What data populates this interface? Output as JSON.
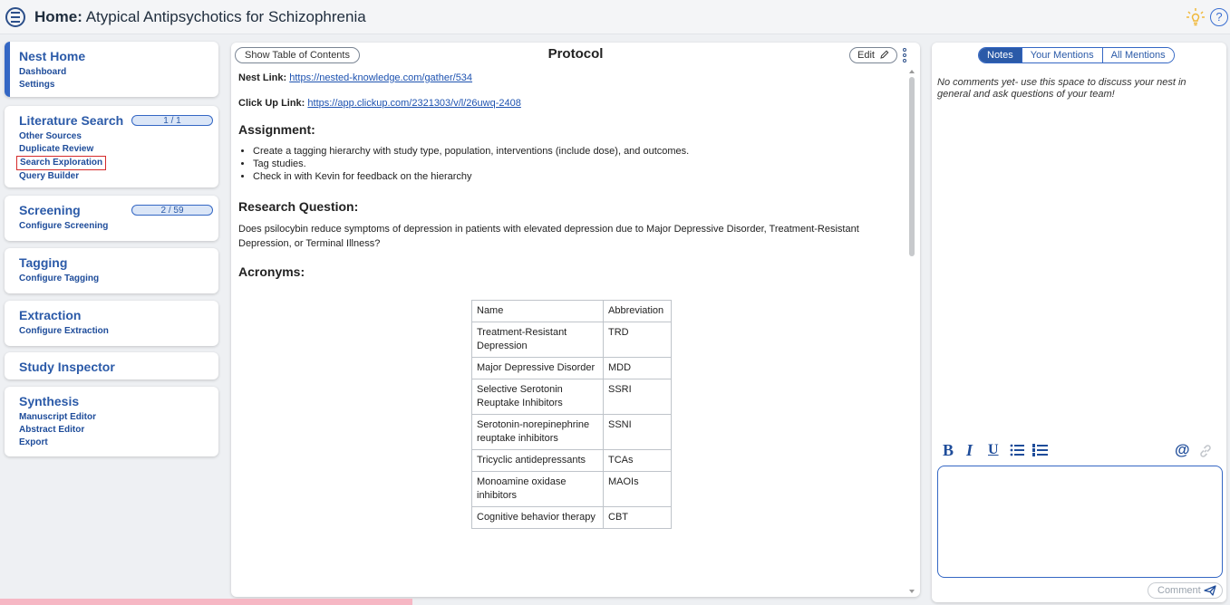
{
  "header": {
    "title_bold": "Home:",
    "title_rest": " Atypical Antipsychotics for Schizophrenia"
  },
  "sidebar": {
    "nest_home": {
      "title": "Nest Home",
      "links": [
        "Dashboard",
        "Settings"
      ]
    },
    "literature_search": {
      "title": "Literature Search",
      "progress": "1 / 1",
      "links": [
        "Other Sources",
        "Duplicate Review",
        "Search Exploration",
        "Query Builder"
      ]
    },
    "screening": {
      "title": "Screening",
      "progress": "2 / 59",
      "links": [
        "Configure Screening"
      ]
    },
    "tagging": {
      "title": "Tagging",
      "links": [
        "Configure Tagging"
      ]
    },
    "extraction": {
      "title": "Extraction",
      "links": [
        "Configure Extraction"
      ]
    },
    "study_inspector": {
      "title": "Study Inspector"
    },
    "synthesis": {
      "title": "Synthesis",
      "links": [
        "Manuscript Editor",
        "Abstract Editor",
        "Export"
      ]
    }
  },
  "protocol": {
    "toc_label": "Show Table of Contents",
    "title": "Protocol",
    "edit_label": "Edit",
    "nest_link_label": "Nest Link:",
    "nest_link_url": "https://nested-knowledge.com/gather/534",
    "clickup_label": "Click Up Link:",
    "clickup_url": "https://app.clickup.com/2321303/v/l/26uwq-2408",
    "assignment_heading": "Assignment:",
    "assignment_items": [
      "Create a tagging hierarchy with study type, population, interventions (include dose), and outcomes.",
      "Tag studies.",
      "Check in with Kevin for feedback on the hierarchy"
    ],
    "research_heading": "Research Question:",
    "research_text": "Does psilocybin reduce symptoms of depression in patients with elevated depression due to Major Depressive Disorder, Treatment-Resistant Depression, or Terminal Illness?",
    "acronyms_heading": "Acronyms:",
    "acronyms_table": {
      "headers": [
        "Name",
        "Abbreviation"
      ],
      "rows": [
        [
          "Treatment-Resistant Depression",
          "TRD"
        ],
        [
          "Major Depressive Disorder",
          "MDD"
        ],
        [
          "Selective Serotonin Reuptake Inhibitors",
          "SSRI"
        ],
        [
          "Serotonin-norepinephrine reuptake inhibitors",
          "SSNI"
        ],
        [
          "Tricyclic antidepressants",
          "TCAs"
        ],
        [
          "Monoamine oxidase inhibitors",
          "MAOIs"
        ],
        [
          "Cognitive behavior therapy",
          "CBT"
        ]
      ]
    }
  },
  "notes": {
    "tabs": [
      "Notes",
      "Your Mentions",
      "All Mentions"
    ],
    "active_tab": "Notes",
    "empty_text": "No comments yet- use this space to discuss your nest in general and ask questions of your team!",
    "comment_label": "Comment"
  },
  "colors": {
    "accent": "#2b5aa8",
    "highlight_box": "#d52b2b",
    "status_bar": "#f6b7c4"
  }
}
